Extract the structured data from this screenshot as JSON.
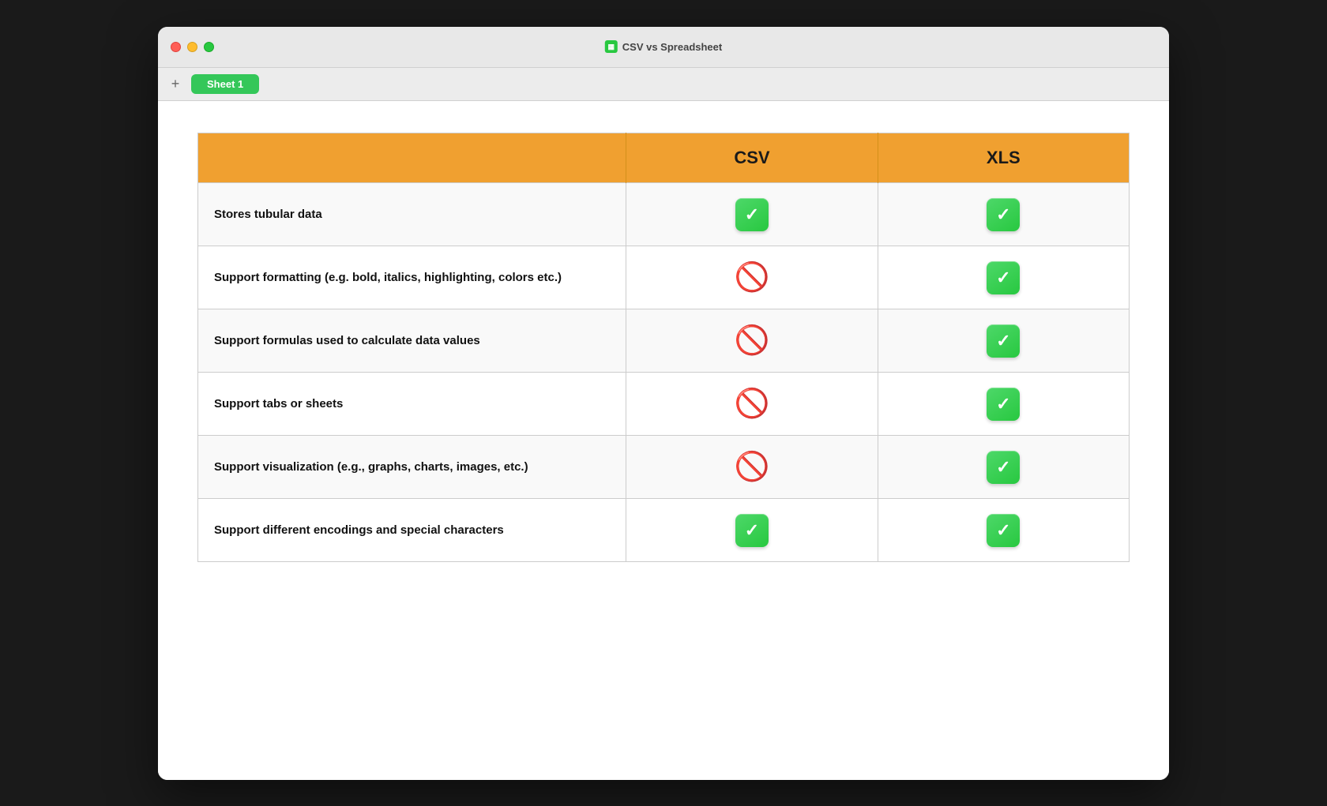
{
  "window": {
    "title": "CSV vs Spreadsheet",
    "title_icon": "📊"
  },
  "controls": {
    "close_label": "",
    "minimize_label": "",
    "maximize_label": ""
  },
  "tabs": {
    "add_label": "+",
    "active_tab": "Sheet 1"
  },
  "table": {
    "columns": [
      "",
      "CSV",
      "XLS"
    ],
    "rows": [
      {
        "feature": "Stores tubular data",
        "csv": "check",
        "xls": "check"
      },
      {
        "feature": "Support formatting (e.g. bold, italics, highlighting, colors etc.)",
        "csv": "no",
        "xls": "check"
      },
      {
        "feature": "Support formulas used to calculate data values",
        "csv": "no",
        "xls": "check"
      },
      {
        "feature": "Support tabs or sheets",
        "csv": "no",
        "xls": "check"
      },
      {
        "feature": "Support visualization (e.g., graphs, charts, images, etc.)",
        "csv": "no",
        "xls": "check"
      },
      {
        "feature": "Support different encodings and special characters",
        "csv": "check",
        "xls": "check"
      }
    ]
  },
  "icons": {
    "check_symbol": "✓",
    "no_symbol": "🚫"
  }
}
